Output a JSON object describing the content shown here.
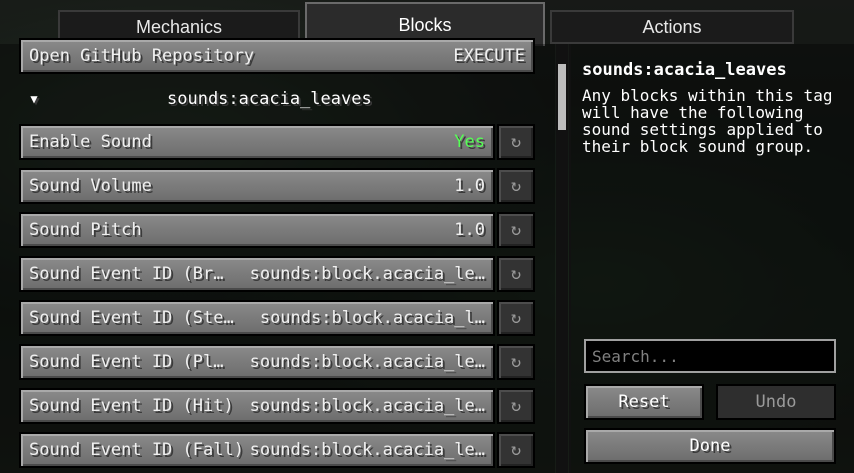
{
  "tabs": [
    {
      "label": "Mechanics"
    },
    {
      "label": "Blocks"
    },
    {
      "label": "Actions"
    }
  ],
  "list": {
    "top_item": {
      "label": "Open GitHub Repository",
      "value": "EXECUTE"
    },
    "group": {
      "arrow": "▼",
      "title": "sounds:acacia_leaves"
    },
    "rows": [
      {
        "label": "Enable Sound",
        "value": "Yes"
      },
      {
        "label": "Sound Volume",
        "value": "1.0"
      },
      {
        "label": "Sound Pitch",
        "value": "1.0"
      },
      {
        "label": "Sound Event ID (Br…",
        "value": "sounds:block.acacia_le…"
      },
      {
        "label": "Sound Event ID (Ste…",
        "value": "sounds:block.acacia_l…"
      },
      {
        "label": "Sound Event ID (Pl…",
        "value": "sounds:block.acacia_le…"
      },
      {
        "label": "Sound Event ID (Hit)",
        "value": "sounds:block.acacia_le…"
      },
      {
        "label": "Sound Event ID (Fall)",
        "value": "sounds:block.acacia_le…"
      }
    ],
    "reset_icon": "↻"
  },
  "panel": {
    "title": "sounds:acacia_leaves",
    "description": "Any blocks within this tag will have the following sound settings applied to their block sound group.",
    "search_placeholder": "Search...",
    "reset_label": "Reset",
    "undo_label": "Undo",
    "done_label": "Done"
  },
  "colors": {
    "enabled_value": "#55ff55"
  }
}
